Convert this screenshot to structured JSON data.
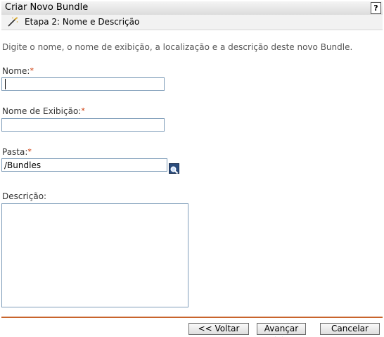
{
  "title_bar": {
    "title": "Criar Novo Bundle",
    "help_label": "?"
  },
  "step": {
    "icon": "wizard-wand-icon",
    "text": "Etapa 2: Nome e Descrição"
  },
  "instruction": "Digite o nome, o nome de exibição, a localização e a descrição deste novo Bundle.",
  "form": {
    "required_marker": "*",
    "name": {
      "label": "Nome:",
      "value": ""
    },
    "display_name": {
      "label": "Nome de Exibição:",
      "value": ""
    },
    "folder": {
      "label": "Pasta:",
      "value": "/Bundles",
      "browse_icon": "magnifier-search-icon"
    },
    "description": {
      "label": "Descrição:",
      "value": ""
    }
  },
  "buttons": {
    "back": "<< Voltar",
    "next": "Avançar >>",
    "cancel": "Cancelar"
  },
  "colors": {
    "divider": "#c8642c",
    "required": "#cc3300",
    "input_border": "#7f9db9"
  }
}
